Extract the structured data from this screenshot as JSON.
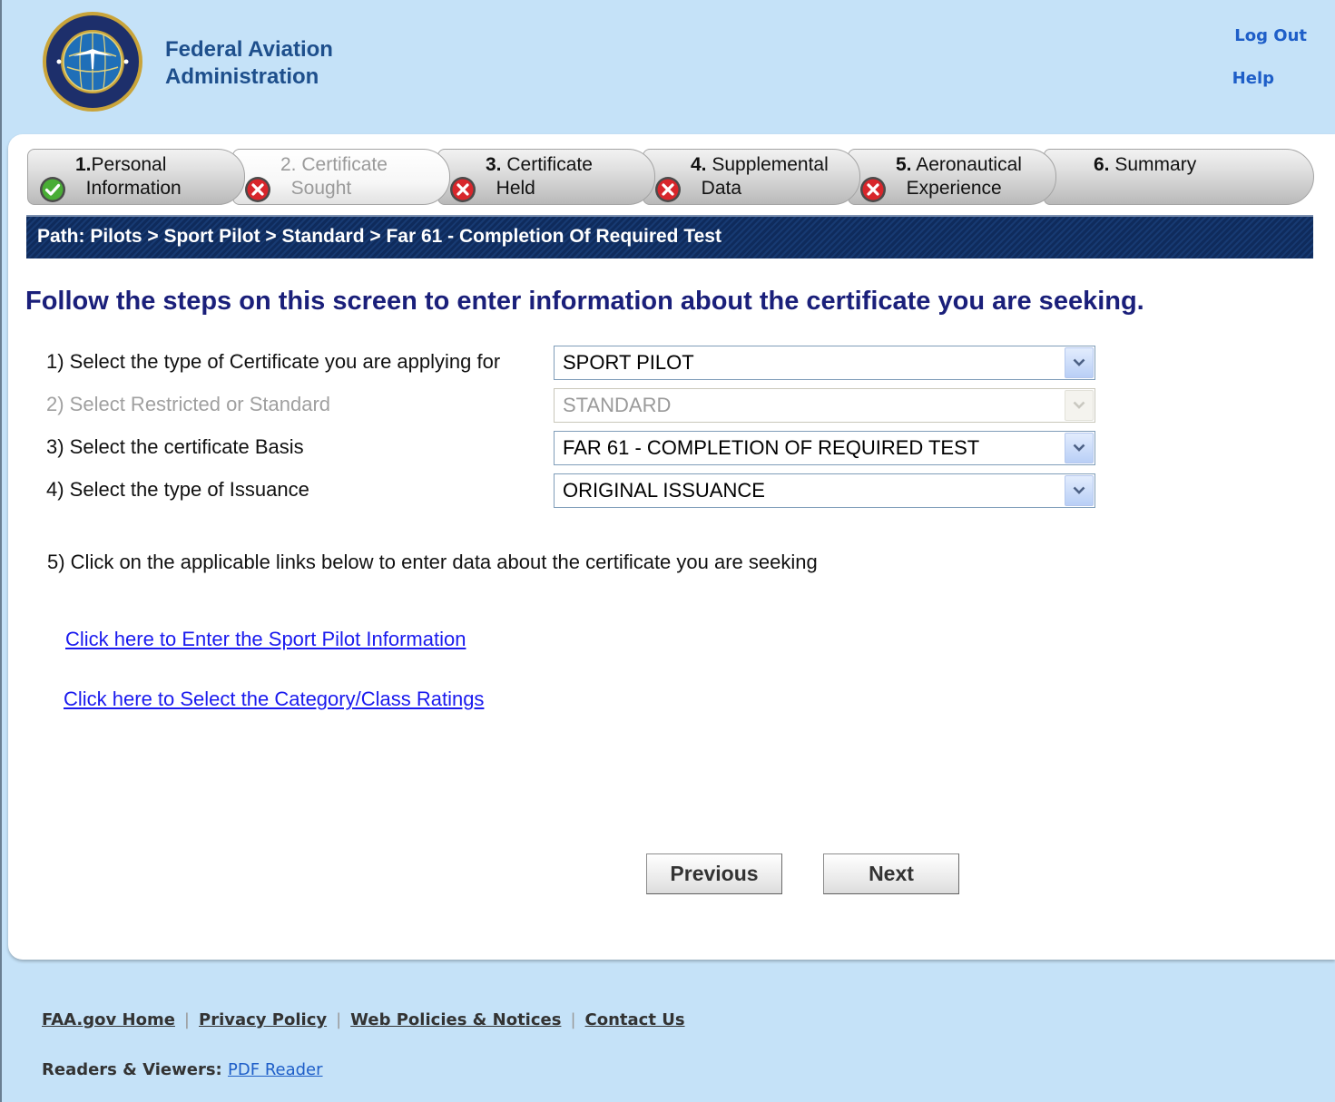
{
  "header": {
    "agency_line1": "Federal Aviation",
    "agency_line2": "Administration",
    "logout_label": "Log Out",
    "help_label": "Help"
  },
  "steps": [
    {
      "num": "1.",
      "line1": "Personal",
      "line2": "Information",
      "status": "complete",
      "icon": "check-icon"
    },
    {
      "num": "2.",
      "line1": "Certificate",
      "line2": "Sought",
      "status": "incomplete",
      "icon": "x-icon",
      "active": true
    },
    {
      "num": "3.",
      "line1": "Certificate",
      "line2": "Held",
      "status": "incomplete",
      "icon": "x-icon"
    },
    {
      "num": "4.",
      "line1": "Supplemental",
      "line2": "Data",
      "status": "incomplete",
      "icon": "x-icon"
    },
    {
      "num": "5.",
      "line1": "Aeronautical",
      "line2": "Experience",
      "status": "incomplete",
      "icon": "x-icon"
    },
    {
      "num": "6.",
      "line1": "Summary"
    }
  ],
  "path": "Path: Pilots > Sport Pilot > Standard > Far 61 - Completion Of Required Test",
  "heading": "Follow the steps on this screen to enter information about the certificate you are seeking.",
  "questions": {
    "q1": {
      "label": "1) Select the type of Certificate you are applying for",
      "value": "SPORT PILOT"
    },
    "q2": {
      "label": "2) Select Restricted or Standard",
      "value": "STANDARD",
      "disabled": true
    },
    "q3": {
      "label": "3) Select the certificate Basis",
      "value": "FAR 61 - COMPLETION OF REQUIRED TEST"
    },
    "q4": {
      "label": "4) Select the type of Issuance",
      "value": "ORIGINAL ISSUANCE"
    },
    "q5": {
      "label": "5) Click on the applicable links below to enter data about the certificate you are seeking"
    }
  },
  "links": {
    "sport_pilot": "Click here to Enter the Sport Pilot Information",
    "category_class": "Click here to Select the Category/Class Ratings"
  },
  "buttons": {
    "previous": "Previous",
    "next": "Next"
  },
  "footer": {
    "links": [
      "FAA.gov Home",
      "Privacy Policy",
      "Web Policies & Notices",
      "Contact Us"
    ],
    "separator": "|",
    "readers_label": "Readers & Viewers:",
    "pdf_reader": "PDF Reader"
  },
  "colors": {
    "page_bg": "#c5e2f8",
    "path_bar": "#0f2b5c",
    "heading": "#1a1f7a",
    "link": "#1a1aee",
    "check_green": "#3fa62e",
    "x_red": "#d8262b"
  }
}
